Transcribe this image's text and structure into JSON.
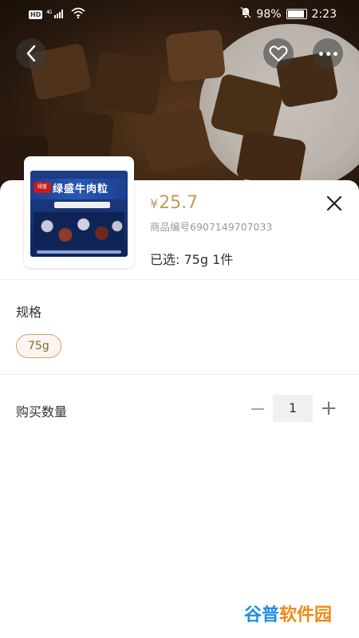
{
  "status_bar": {
    "network_badge": "HD",
    "network_type": "4G",
    "battery": "98%",
    "time": "2:23"
  },
  "topbar": {
    "back_icon": "chevron-left-icon",
    "favorite_icon": "heart-icon",
    "more_icon": "more-dots-icon"
  },
  "product": {
    "image_icon": "product-package-image",
    "package_name": "绿盛牛肉粒",
    "brand_badge": "绿盛",
    "price_symbol": "¥",
    "price": "25.7",
    "code": "商品编号6907149707033",
    "selected": "已选:  75g  1件"
  },
  "spec": {
    "label": "规格",
    "options": [
      "75g"
    ]
  },
  "quantity": {
    "label": "购买数量",
    "value": "1",
    "minus": "−",
    "plus": "+"
  },
  "watermark": {
    "part1": "谷普",
    "part2": "软件园"
  },
  "colors": {
    "accent": "#c49a5a",
    "chip_border": "#c9a46c"
  }
}
